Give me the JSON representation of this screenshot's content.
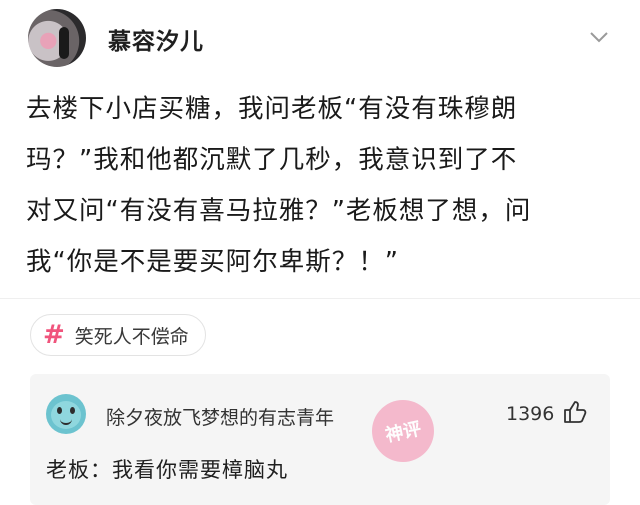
{
  "post": {
    "author": "慕容汐儿",
    "lines": [
      "去楼下小店买糖，我问老板“有没有珠穆朗",
      "玛？”我和他都沉默了几秒，我意识到了不",
      "对又问“有没有喜马拉雅？”老板想了想，问",
      "我“你是不是要买阿尔卑斯？！”"
    ]
  },
  "topic": {
    "hash": "#",
    "label": "笑死人不偿命"
  },
  "comment": {
    "author": "除夕夜放飞梦想的有志青年",
    "likes": "1396",
    "text": "老板：我看你需要樟脑丸"
  },
  "watermark": {
    "text": "神评"
  },
  "icons": {
    "chevron": "chevron-down-icon",
    "like": "thumbs-up-icon"
  },
  "colors": {
    "topic_hash": "#f0547c",
    "comment_bg": "#f5f5f5",
    "watermark": "#f4b3c8"
  }
}
